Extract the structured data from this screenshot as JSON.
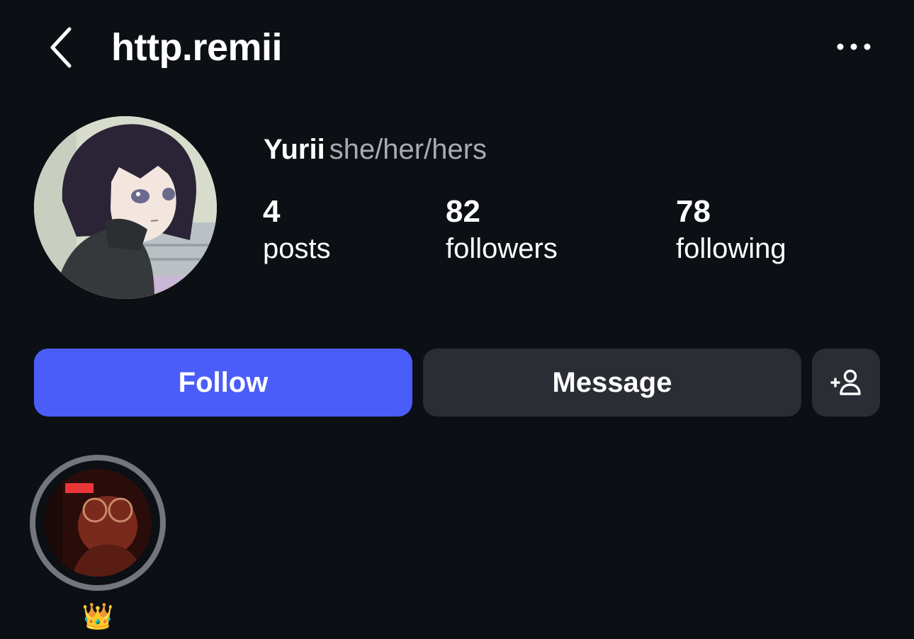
{
  "header": {
    "username": "http.remii",
    "back_icon": "chevron-left-icon",
    "more_icon": "more-horizontal-icon"
  },
  "profile": {
    "display_name": "Yurii",
    "pronouns": "she/her/hers",
    "avatar_icon": "profile-avatar"
  },
  "stats": {
    "posts": {
      "value": "4",
      "label": "posts"
    },
    "followers": {
      "value": "82",
      "label": "followers"
    },
    "following": {
      "value": "78",
      "label": "following"
    }
  },
  "actions": {
    "follow_label": "Follow",
    "message_label": "Message",
    "suggest_icon": "add-person-icon"
  },
  "highlights": [
    {
      "label": "👑"
    }
  ],
  "colors": {
    "background": "#0c0f14",
    "follow_button": "#4a5df9",
    "secondary_button": "#2a2d34",
    "muted_text": "#a9abb1",
    "highlight_ring": "#73767d"
  }
}
